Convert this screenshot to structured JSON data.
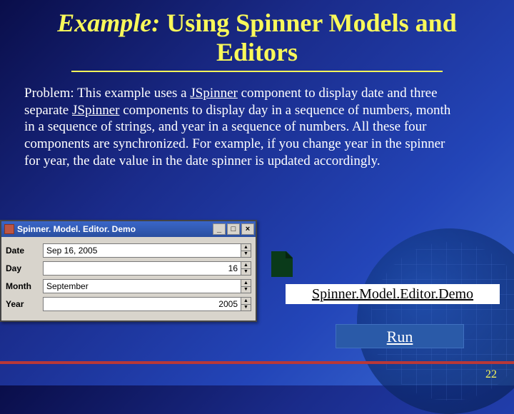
{
  "title": {
    "prefix": "Example:",
    "main": " Using Spinner Models and Editors"
  },
  "body": {
    "lead": "Problem: This example uses a ",
    "jspinner": "JSpinner",
    "mid1": " component to display date and three separate ",
    "mid2": " components to display day in a sequence of numbers, month in a sequence of strings, and year in a sequence of numbers. All these four components are synchronized. For example, if you change year in the spinner for year, the date value in the date spinner is updated accordingly."
  },
  "window": {
    "title": "Spinner. Model. Editor. Demo",
    "fields": {
      "date": {
        "label": "Date",
        "value": "Sep 16, 2005"
      },
      "day": {
        "label": "Day",
        "value": "16"
      },
      "month": {
        "label": "Month",
        "value": "September"
      },
      "year": {
        "label": "Year",
        "value": "2005"
      }
    }
  },
  "demo_link": "Spinner.Model.Editor.Demo",
  "run_label": "Run",
  "page_number": "22"
}
